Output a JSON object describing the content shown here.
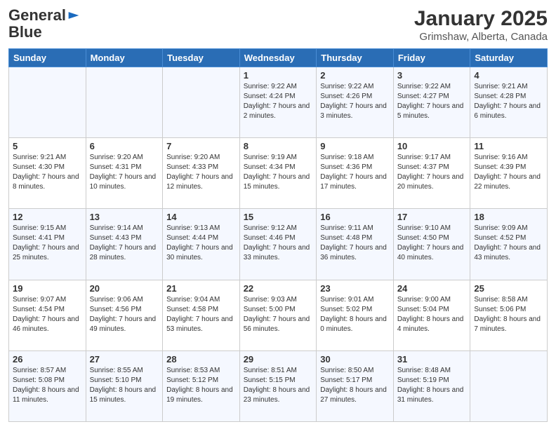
{
  "header": {
    "logo_line1": "General",
    "logo_line2": "Blue",
    "month": "January 2025",
    "location": "Grimshaw, Alberta, Canada"
  },
  "days_of_week": [
    "Sunday",
    "Monday",
    "Tuesday",
    "Wednesday",
    "Thursday",
    "Friday",
    "Saturday"
  ],
  "weeks": [
    [
      {
        "day": "",
        "sunrise": "",
        "sunset": "",
        "daylight": ""
      },
      {
        "day": "",
        "sunrise": "",
        "sunset": "",
        "daylight": ""
      },
      {
        "day": "",
        "sunrise": "",
        "sunset": "",
        "daylight": ""
      },
      {
        "day": "1",
        "sunrise": "Sunrise: 9:22 AM",
        "sunset": "Sunset: 4:24 PM",
        "daylight": "Daylight: 7 hours and 2 minutes."
      },
      {
        "day": "2",
        "sunrise": "Sunrise: 9:22 AM",
        "sunset": "Sunset: 4:26 PM",
        "daylight": "Daylight: 7 hours and 3 minutes."
      },
      {
        "day": "3",
        "sunrise": "Sunrise: 9:22 AM",
        "sunset": "Sunset: 4:27 PM",
        "daylight": "Daylight: 7 hours and 5 minutes."
      },
      {
        "day": "4",
        "sunrise": "Sunrise: 9:21 AM",
        "sunset": "Sunset: 4:28 PM",
        "daylight": "Daylight: 7 hours and 6 minutes."
      }
    ],
    [
      {
        "day": "5",
        "sunrise": "Sunrise: 9:21 AM",
        "sunset": "Sunset: 4:30 PM",
        "daylight": "Daylight: 7 hours and 8 minutes."
      },
      {
        "day": "6",
        "sunrise": "Sunrise: 9:20 AM",
        "sunset": "Sunset: 4:31 PM",
        "daylight": "Daylight: 7 hours and 10 minutes."
      },
      {
        "day": "7",
        "sunrise": "Sunrise: 9:20 AM",
        "sunset": "Sunset: 4:33 PM",
        "daylight": "Daylight: 7 hours and 12 minutes."
      },
      {
        "day": "8",
        "sunrise": "Sunrise: 9:19 AM",
        "sunset": "Sunset: 4:34 PM",
        "daylight": "Daylight: 7 hours and 15 minutes."
      },
      {
        "day": "9",
        "sunrise": "Sunrise: 9:18 AM",
        "sunset": "Sunset: 4:36 PM",
        "daylight": "Daylight: 7 hours and 17 minutes."
      },
      {
        "day": "10",
        "sunrise": "Sunrise: 9:17 AM",
        "sunset": "Sunset: 4:37 PM",
        "daylight": "Daylight: 7 hours and 20 minutes."
      },
      {
        "day": "11",
        "sunrise": "Sunrise: 9:16 AM",
        "sunset": "Sunset: 4:39 PM",
        "daylight": "Daylight: 7 hours and 22 minutes."
      }
    ],
    [
      {
        "day": "12",
        "sunrise": "Sunrise: 9:15 AM",
        "sunset": "Sunset: 4:41 PM",
        "daylight": "Daylight: 7 hours and 25 minutes."
      },
      {
        "day": "13",
        "sunrise": "Sunrise: 9:14 AM",
        "sunset": "Sunset: 4:43 PM",
        "daylight": "Daylight: 7 hours and 28 minutes."
      },
      {
        "day": "14",
        "sunrise": "Sunrise: 9:13 AM",
        "sunset": "Sunset: 4:44 PM",
        "daylight": "Daylight: 7 hours and 30 minutes."
      },
      {
        "day": "15",
        "sunrise": "Sunrise: 9:12 AM",
        "sunset": "Sunset: 4:46 PM",
        "daylight": "Daylight: 7 hours and 33 minutes."
      },
      {
        "day": "16",
        "sunrise": "Sunrise: 9:11 AM",
        "sunset": "Sunset: 4:48 PM",
        "daylight": "Daylight: 7 hours and 36 minutes."
      },
      {
        "day": "17",
        "sunrise": "Sunrise: 9:10 AM",
        "sunset": "Sunset: 4:50 PM",
        "daylight": "Daylight: 7 hours and 40 minutes."
      },
      {
        "day": "18",
        "sunrise": "Sunrise: 9:09 AM",
        "sunset": "Sunset: 4:52 PM",
        "daylight": "Daylight: 7 hours and 43 minutes."
      }
    ],
    [
      {
        "day": "19",
        "sunrise": "Sunrise: 9:07 AM",
        "sunset": "Sunset: 4:54 PM",
        "daylight": "Daylight: 7 hours and 46 minutes."
      },
      {
        "day": "20",
        "sunrise": "Sunrise: 9:06 AM",
        "sunset": "Sunset: 4:56 PM",
        "daylight": "Daylight: 7 hours and 49 minutes."
      },
      {
        "day": "21",
        "sunrise": "Sunrise: 9:04 AM",
        "sunset": "Sunset: 4:58 PM",
        "daylight": "Daylight: 7 hours and 53 minutes."
      },
      {
        "day": "22",
        "sunrise": "Sunrise: 9:03 AM",
        "sunset": "Sunset: 5:00 PM",
        "daylight": "Daylight: 7 hours and 56 minutes."
      },
      {
        "day": "23",
        "sunrise": "Sunrise: 9:01 AM",
        "sunset": "Sunset: 5:02 PM",
        "daylight": "Daylight: 8 hours and 0 minutes."
      },
      {
        "day": "24",
        "sunrise": "Sunrise: 9:00 AM",
        "sunset": "Sunset: 5:04 PM",
        "daylight": "Daylight: 8 hours and 4 minutes."
      },
      {
        "day": "25",
        "sunrise": "Sunrise: 8:58 AM",
        "sunset": "Sunset: 5:06 PM",
        "daylight": "Daylight: 8 hours and 7 minutes."
      }
    ],
    [
      {
        "day": "26",
        "sunrise": "Sunrise: 8:57 AM",
        "sunset": "Sunset: 5:08 PM",
        "daylight": "Daylight: 8 hours and 11 minutes."
      },
      {
        "day": "27",
        "sunrise": "Sunrise: 8:55 AM",
        "sunset": "Sunset: 5:10 PM",
        "daylight": "Daylight: 8 hours and 15 minutes."
      },
      {
        "day": "28",
        "sunrise": "Sunrise: 8:53 AM",
        "sunset": "Sunset: 5:12 PM",
        "daylight": "Daylight: 8 hours and 19 minutes."
      },
      {
        "day": "29",
        "sunrise": "Sunrise: 8:51 AM",
        "sunset": "Sunset: 5:15 PM",
        "daylight": "Daylight: 8 hours and 23 minutes."
      },
      {
        "day": "30",
        "sunrise": "Sunrise: 8:50 AM",
        "sunset": "Sunset: 5:17 PM",
        "daylight": "Daylight: 8 hours and 27 minutes."
      },
      {
        "day": "31",
        "sunrise": "Sunrise: 8:48 AM",
        "sunset": "Sunset: 5:19 PM",
        "daylight": "Daylight: 8 hours and 31 minutes."
      },
      {
        "day": "",
        "sunrise": "",
        "sunset": "",
        "daylight": ""
      }
    ]
  ]
}
